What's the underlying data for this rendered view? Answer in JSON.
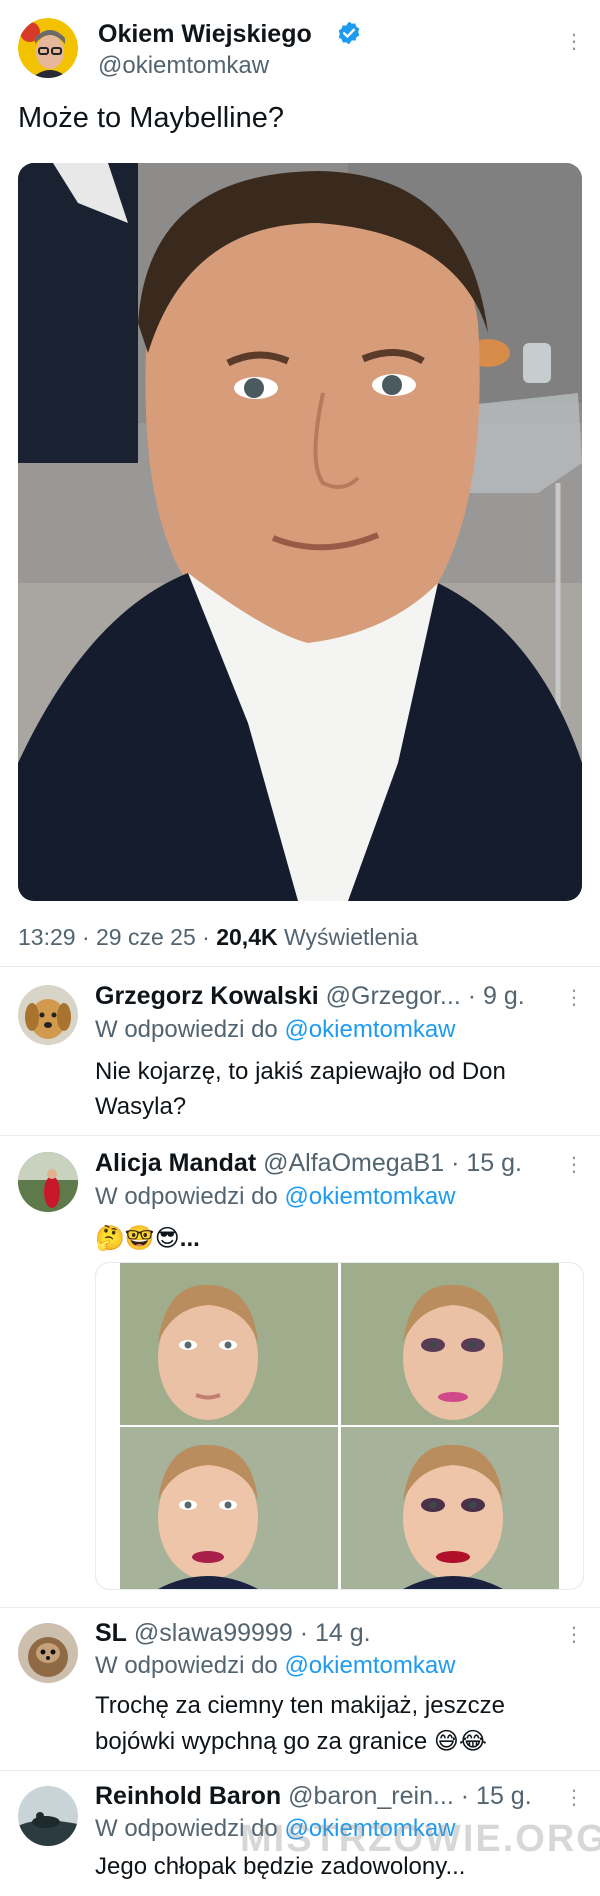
{
  "main_tweet": {
    "author_name": "Okiem Wiejskiego",
    "handle": "@okiemtomkaw",
    "verified_icon": "verified-badge-icon",
    "text": "Może to Maybelline?",
    "time": "13:29",
    "sep1": "·",
    "date": "29 cze 25",
    "sep2": "·",
    "views_count": "20,4K",
    "views_label": "Wyświetlenia",
    "more_icon": "more-dots-icon"
  },
  "replies": [
    {
      "author_name": "Grzegorz Kowalski",
      "handle": "@Grzegor...",
      "meta": "· 9 g.",
      "reply_prefix": "W odpowiedzi do",
      "reply_to": "@okiemtomkaw",
      "text_line1": "Nie kojarzę, to jakiś zapiewajło od Don",
      "text_line2": "Wasyla?"
    },
    {
      "author_name": "Alicja Mandat",
      "handle": "@AlfaOmegaB1",
      "meta": "· 15 g.",
      "reply_prefix": "W odpowiedzi do",
      "reply_to": "@okiemtomkaw",
      "text_line1": "🤔🤓😎..."
    },
    {
      "author_name": "SL",
      "handle": "@slawa99999",
      "meta": "· 14 g.",
      "reply_prefix": "W odpowiedzi do",
      "reply_to": "@okiemtomkaw",
      "text_line1": "Trochę za ciemny ten makijaż, jeszcze",
      "text_line2": "bojówki wypchną go za granice 😅😂"
    },
    {
      "author_name": "Reinhold Baron",
      "handle": "@baron_rein...",
      "meta": "· 15 g.",
      "reply_prefix": "W odpowiedzi do",
      "reply_to": "@okiemtomkaw",
      "text_line1": "Jego chłopak będzie zadowolony..."
    }
  ],
  "watermark": "MISTRZOWIE.ORG",
  "colors": {
    "link": "#1d9bf0",
    "verified": "#1d9bf0",
    "muted": "#536471",
    "text": "#0f1419"
  }
}
